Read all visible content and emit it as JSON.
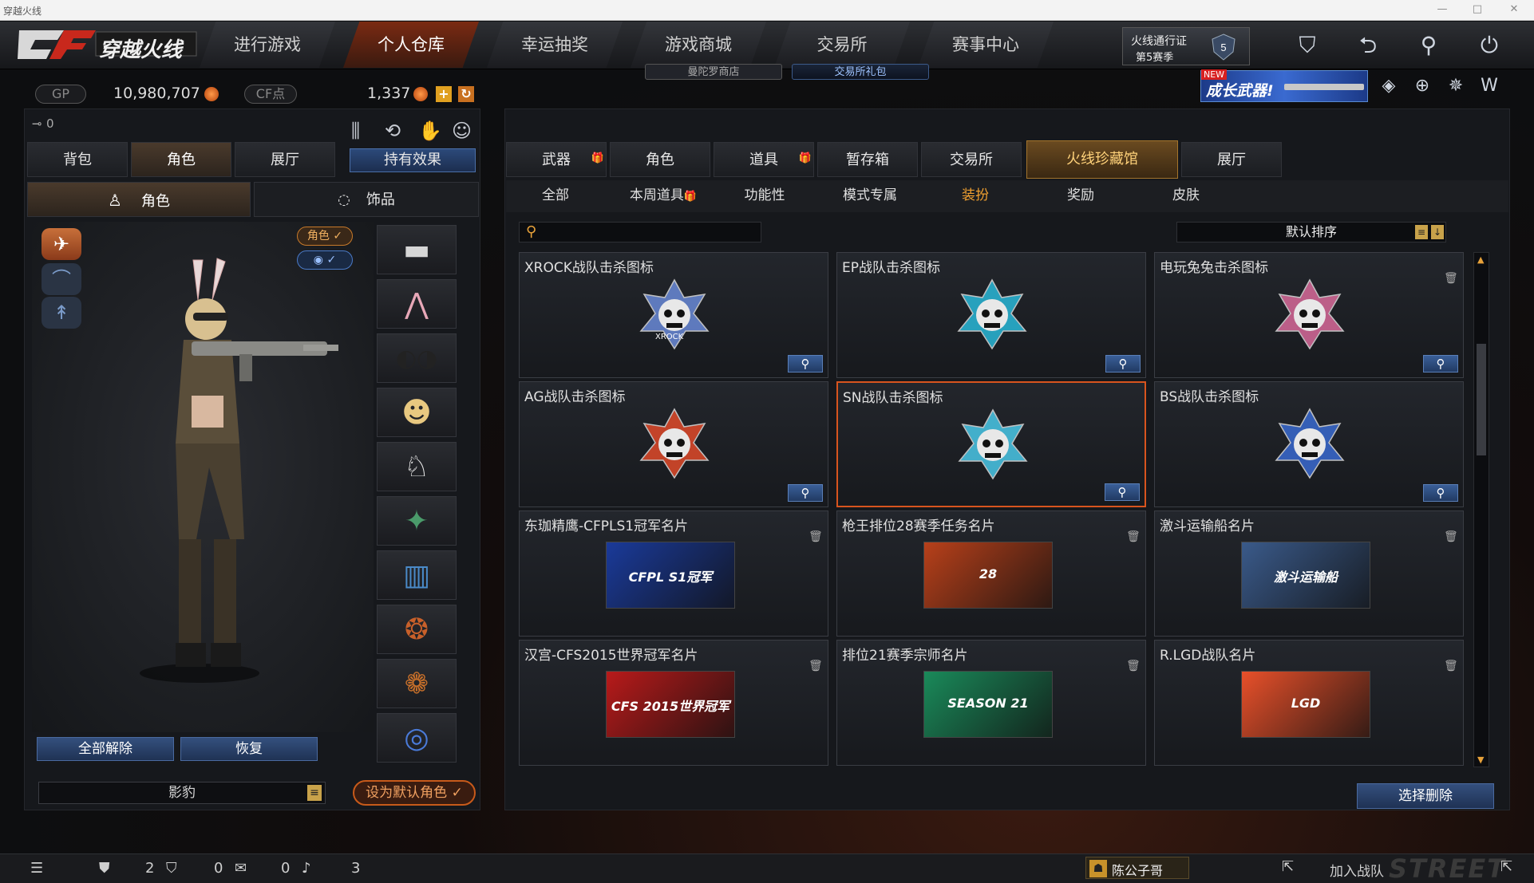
{
  "window": {
    "title": "穿越火线",
    "controls": [
      "—",
      "□",
      "✕"
    ]
  },
  "nav": {
    "logo_text": "穿越火线",
    "tabs": [
      "进行游戏",
      "个人仓库",
      "幸运抽奖",
      "游戏商城",
      "交易所",
      "赛事中心"
    ],
    "active_tab": "个人仓库",
    "sub_pills": [
      "曼陀罗商店",
      "交易所礼包"
    ],
    "pass_label": "火线通行证",
    "pass_season": "第5赛季",
    "promo_new": "NEW",
    "promo_text": "成长武器!"
  },
  "currency": {
    "gp_label": "GP",
    "gp_value": "10,980,707",
    "cf_label": "CF点",
    "cf_value": "1,337"
  },
  "left": {
    "key_count": "0",
    "tabs": [
      "背包",
      "角色",
      "展厅",
      "持有效果"
    ],
    "active_tab": "角色",
    "subtabs": [
      "角色",
      "饰品"
    ],
    "role_toggle": "角色",
    "buttons": {
      "unequip_all": "全部解除",
      "restore": "恢复",
      "set_default": "设为默认角色"
    },
    "role_select": "影豹",
    "slot_icons": [
      "rifle-icon",
      "bunny-ears-icon",
      "goggles-icon",
      "doll-icon",
      "bunny-icon",
      "grenade-icon",
      "magazine-icon",
      "tiger-emblem-icon",
      "tiger-ring-icon",
      "bracelet-icon"
    ]
  },
  "right": {
    "tabs": [
      "武器",
      "角色",
      "道具",
      "暂存箱",
      "交易所",
      "火线珍藏馆",
      "展厅"
    ],
    "active_tab": "火线珍藏馆",
    "subtabs": [
      "全部",
      "本周道具",
      "功能性",
      "模式专属",
      "装扮",
      "奖励",
      "皮肤"
    ],
    "active_subtab": "装扮",
    "search_placeholder": "",
    "sort_label": "默认排序",
    "delete_button": "选择删除",
    "items": [
      {
        "title": "XROCK战队击杀图标",
        "kind": "emblem",
        "color": "#6a8ad8",
        "badge": "XROCK",
        "icon": "skull-emblem-icon"
      },
      {
        "title": "EP战队击杀图标",
        "kind": "emblem",
        "color": "#2ab8d8",
        "badge": "",
        "icon": "skull-emblem-icon"
      },
      {
        "title": "电玩兔兔击杀图标",
        "kind": "emblem",
        "color": "#d86a9a",
        "badge": "",
        "icon": "skull-emblem-icon"
      },
      {
        "title": "AG战队击杀图标",
        "kind": "emblem",
        "color": "#e04a2a",
        "badge": "",
        "icon": "skull-emblem-icon"
      },
      {
        "title": "SN战队击杀图标",
        "kind": "emblem",
        "color": "#4ac8e8",
        "badge": "",
        "icon": "skull-emblem-icon"
      },
      {
        "title": "BS战队击杀图标",
        "kind": "emblem",
        "color": "#3a6ad0",
        "badge": "",
        "icon": "skull-emblem-icon"
      },
      {
        "title": "东珈精鹰-CFPLS1冠军名片",
        "kind": "card",
        "color": "#1a3a9a",
        "badge": "CFPL S1冠军",
        "icon": "cfpl-card-icon"
      },
      {
        "title": "枪王排位28赛季任务名片",
        "kind": "card",
        "color": "#b8401a",
        "badge": "28",
        "icon": "season-28-card-icon"
      },
      {
        "title": "激斗运输船名片",
        "kind": "card",
        "color": "#3a5a8a",
        "badge": "激斗运输船",
        "icon": "transport-ship-card-icon"
      },
      {
        "title": "汉宫-CFS2015世界冠军名片",
        "kind": "card",
        "color": "#b81a1a",
        "badge": "CFS 2015世界冠军",
        "icon": "cfs2015-card-icon"
      },
      {
        "title": "排位21赛季宗师名片",
        "kind": "card",
        "color": "#1a8a5a",
        "badge": "SEASON 21",
        "icon": "season-21-card-icon"
      },
      {
        "title": "R.LGD战队名片",
        "kind": "card",
        "color": "#e8502a",
        "badge": "LGD",
        "icon": "lgd-card-icon"
      }
    ]
  },
  "bottom": {
    "count_1": "2",
    "count_2": "0",
    "count_3": "0",
    "count_4": "3",
    "player_name": "陈公子哥",
    "join_team": "加入战队",
    "watermark": "STREET"
  }
}
